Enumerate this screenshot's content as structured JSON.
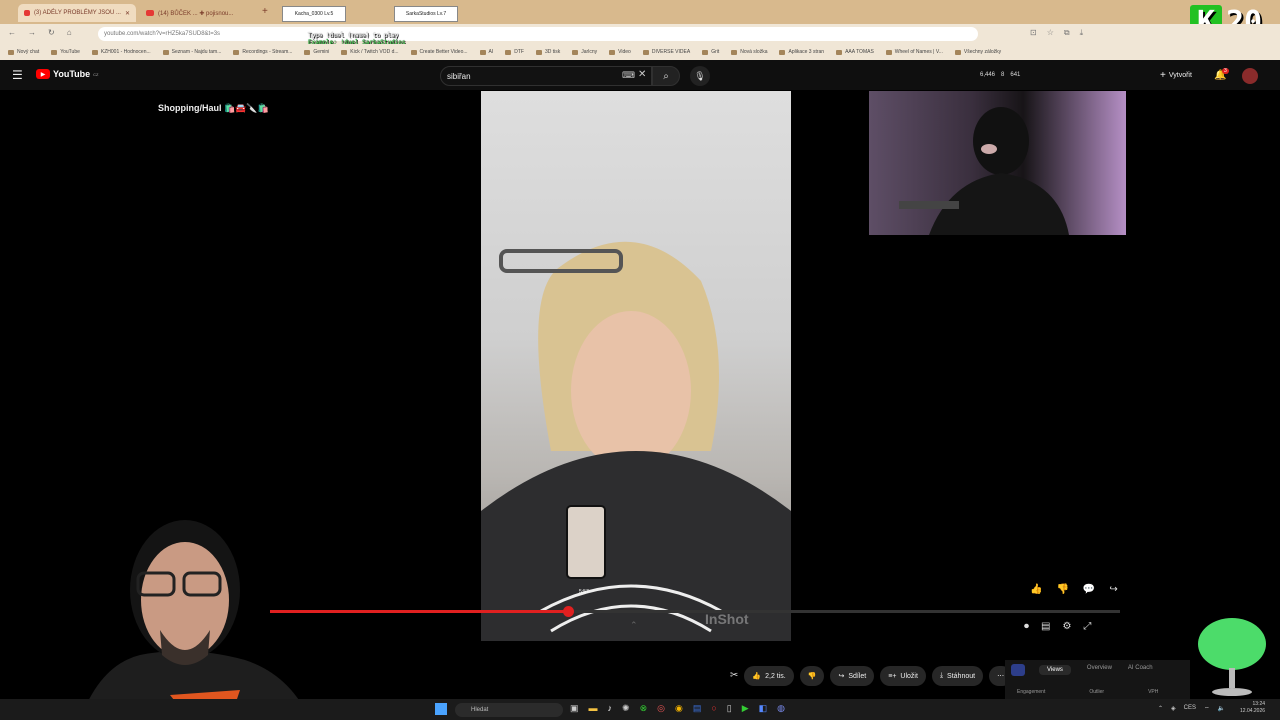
{
  "browser": {
    "tabs": [
      {
        "label": "(3) ADÉLY PROBLÉMY JSOU ...",
        "active": true
      },
      {
        "label": "(14) BŮČEK ... ✚ pojisnou..."
      }
    ],
    "badges": [
      "Kacha_0300  Lv.5",
      "SarkaStudios  Lv.7"
    ],
    "url": "youtube.com/watch?v=rHZ5ka7SUD8&t=3s",
    "bookmarks": [
      "Nový chat",
      "YouTube",
      "KZH001 - Hodnocen...",
      "Seznam - Najdu tam...",
      "Recordings - Stream...",
      "Gemini",
      "Kick / Twitch VOD d...",
      "Create Better Video...",
      "AI",
      "DTF",
      "3D tisk",
      "Jarlcny",
      "Video",
      "DIVERSE VIDEA",
      "Grit",
      "Nová složka",
      "Aplikace 3 stran",
      "AAA TOMAS",
      "Wheel of Names | V...",
      "Všechny záložky"
    ],
    "stream_overlay": {
      "line1": "Type !duel (name) to play",
      "line2": "Example: !duel SarkaStudios"
    }
  },
  "youtube": {
    "logo": "YouTube",
    "region": "CZ",
    "search_value": "sibiřan",
    "stats": {
      "views_live": "6,446",
      "likes": "8",
      "subs": "641"
    },
    "create_label": "Vytvořit",
    "notif_count": "3",
    "video_title": "Shopping/Haul 🛍️🚘🔪🛍️",
    "watermark": "InShot",
    "inset_time": "5:57",
    "progress": 0.35,
    "actions": {
      "likes": "2,2 tis.",
      "share": "Sdílet",
      "save": "Uložit",
      "download": "Stáhnout"
    },
    "extension": {
      "tabs": [
        "Views",
        "Overview",
        "AI Coach"
      ],
      "labels": [
        "Engagement",
        "Outlier",
        "VPH"
      ]
    }
  },
  "taskbar": {
    "search_placeholder": "Hledat",
    "lang": "CES",
    "time": "13:24",
    "date": "12.04.2026"
  },
  "overlay_badge": {
    "letter": "K",
    "number": "20"
  },
  "colors": {
    "accent": "#e02020",
    "tabbar": "#d8b98d",
    "bookmarkbar": "#f0e6d6"
  }
}
